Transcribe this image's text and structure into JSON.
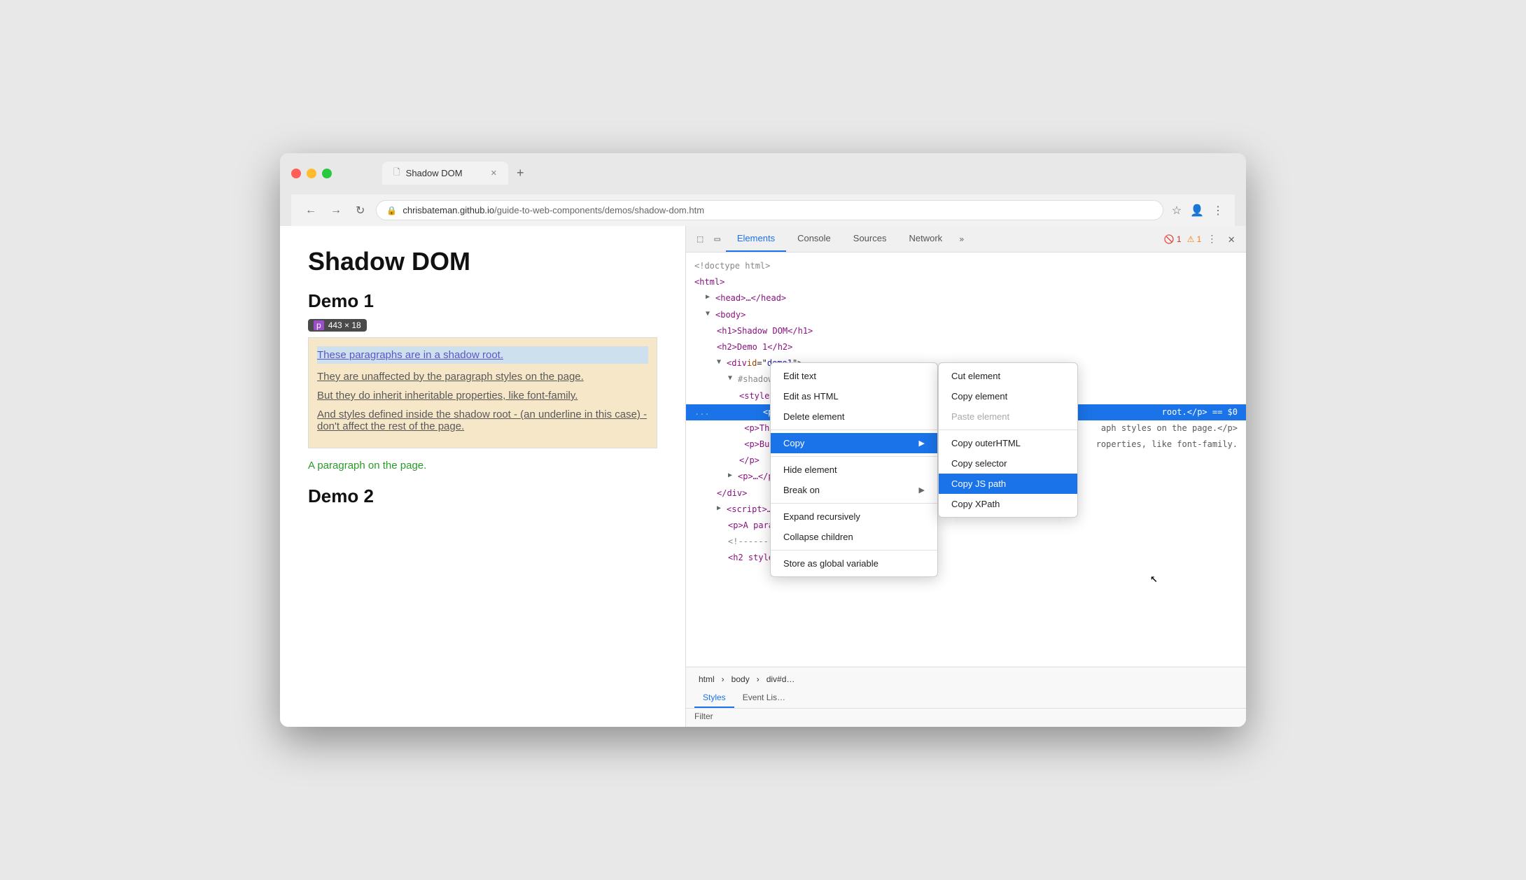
{
  "browser": {
    "tab_title": "Shadow DOM",
    "tab_close": "✕",
    "tab_new": "+",
    "url": "chrisbateman.github.io/guide-to-web-components/demos/shadow-dom.htm",
    "url_prefix": "chrisbateman.github.io",
    "url_suffix": "/guide-to-web-components/demos/shadow-dom.htm"
  },
  "webpage": {
    "title": "Shadow DOM",
    "demo1_heading": "Demo 1",
    "size_badge": "443 × 18",
    "p_label": "p",
    "paragraph1": "These paragraphs are in a shadow root.",
    "paragraph2": "They are unaffected by the paragraph styles on the page.",
    "paragraph3": "But they do inherit inheritable properties, like font-family.",
    "paragraph4": "And styles defined inside the shadow root - (an underline in this case) - don't affect the rest of the page.",
    "green_paragraph": "A paragraph on the page.",
    "demo2_heading": "Demo 2"
  },
  "devtools": {
    "tabs": [
      "Elements",
      "Console",
      "Sources",
      "Network"
    ],
    "active_tab": "Elements",
    "more_icon": "»",
    "errors": "1",
    "warnings": "1",
    "close": "✕",
    "dom": [
      {
        "indent": 0,
        "content": "<!doctype html>",
        "type": "comment"
      },
      {
        "indent": 0,
        "content": "<html>",
        "type": "tag"
      },
      {
        "indent": 1,
        "content": "▶ <head>…</head>",
        "type": "tag"
      },
      {
        "indent": 1,
        "content": "▼ <body>",
        "type": "tag"
      },
      {
        "indent": 2,
        "content": "<h1>Shadow DOM</h1>",
        "type": "tag"
      },
      {
        "indent": 2,
        "content": "<h2>Demo 1</h2>",
        "type": "tag"
      },
      {
        "indent": 2,
        "content": "▼ <div id=\"demo1\">",
        "type": "tag"
      },
      {
        "indent": 3,
        "content": "▼ #shadow-root (open)",
        "type": "shadow"
      },
      {
        "indent": 4,
        "content": "<style>p {text-decoration: underline;}</style>",
        "type": "tag"
      },
      {
        "indent": 4,
        "content": "<p>Thes…",
        "type": "selected"
      },
      {
        "indent": 4,
        "content": "<p>They…",
        "type": "tag-right",
        "right": "aph styles on the page.</p>"
      },
      {
        "indent": 4,
        "content": "<p>But t…",
        "type": "tag-right",
        "right": "roperties, like font-family."
      },
      {
        "indent": 4,
        "content": "…</p>",
        "type": "tag"
      },
      {
        "indent": 3,
        "content": "▶ <p>…</p>",
        "type": "tag"
      },
      {
        "indent": 2,
        "content": "</div>",
        "type": "tag"
      },
      {
        "indent": 2,
        "content": "▶ <script>…</",
        "type": "tag"
      },
      {
        "indent": 3,
        "content": "<p>A paragr…",
        "type": "tag"
      },
      {
        "indent": 3,
        "content": "<!--------…",
        "type": "comment"
      },
      {
        "indent": 3,
        "content": "<h2 style=\"…",
        "type": "tag"
      }
    ],
    "breadcrumb": [
      "html",
      "body",
      "div#d…"
    ],
    "styles_tabs": [
      "Styles",
      "Event Lis…"
    ],
    "filter_placeholder": "Filter"
  },
  "context_menu": {
    "items": [
      {
        "label": "Edit text",
        "type": "item"
      },
      {
        "label": "Edit as HTML",
        "type": "item"
      },
      {
        "label": "Delete element",
        "type": "item"
      },
      {
        "label": "Copy",
        "type": "item-arrow",
        "arrow": "▶"
      },
      {
        "label": "Hide element",
        "type": "item"
      },
      {
        "label": "Break on",
        "type": "item-arrow",
        "arrow": "▶"
      },
      {
        "label": "Expand recursively",
        "type": "item"
      },
      {
        "label": "Collapse children",
        "type": "item"
      },
      {
        "label": "Store as global variable",
        "type": "item"
      }
    ]
  },
  "submenu": {
    "items": [
      {
        "label": "Cut element"
      },
      {
        "label": "Copy element"
      },
      {
        "label": "Paste element",
        "disabled": true
      },
      {
        "label": "Copy outerHTML"
      },
      {
        "label": "Copy selector"
      },
      {
        "label": "Copy JS path",
        "highlighted": true
      },
      {
        "label": "Copy XPath"
      }
    ]
  }
}
